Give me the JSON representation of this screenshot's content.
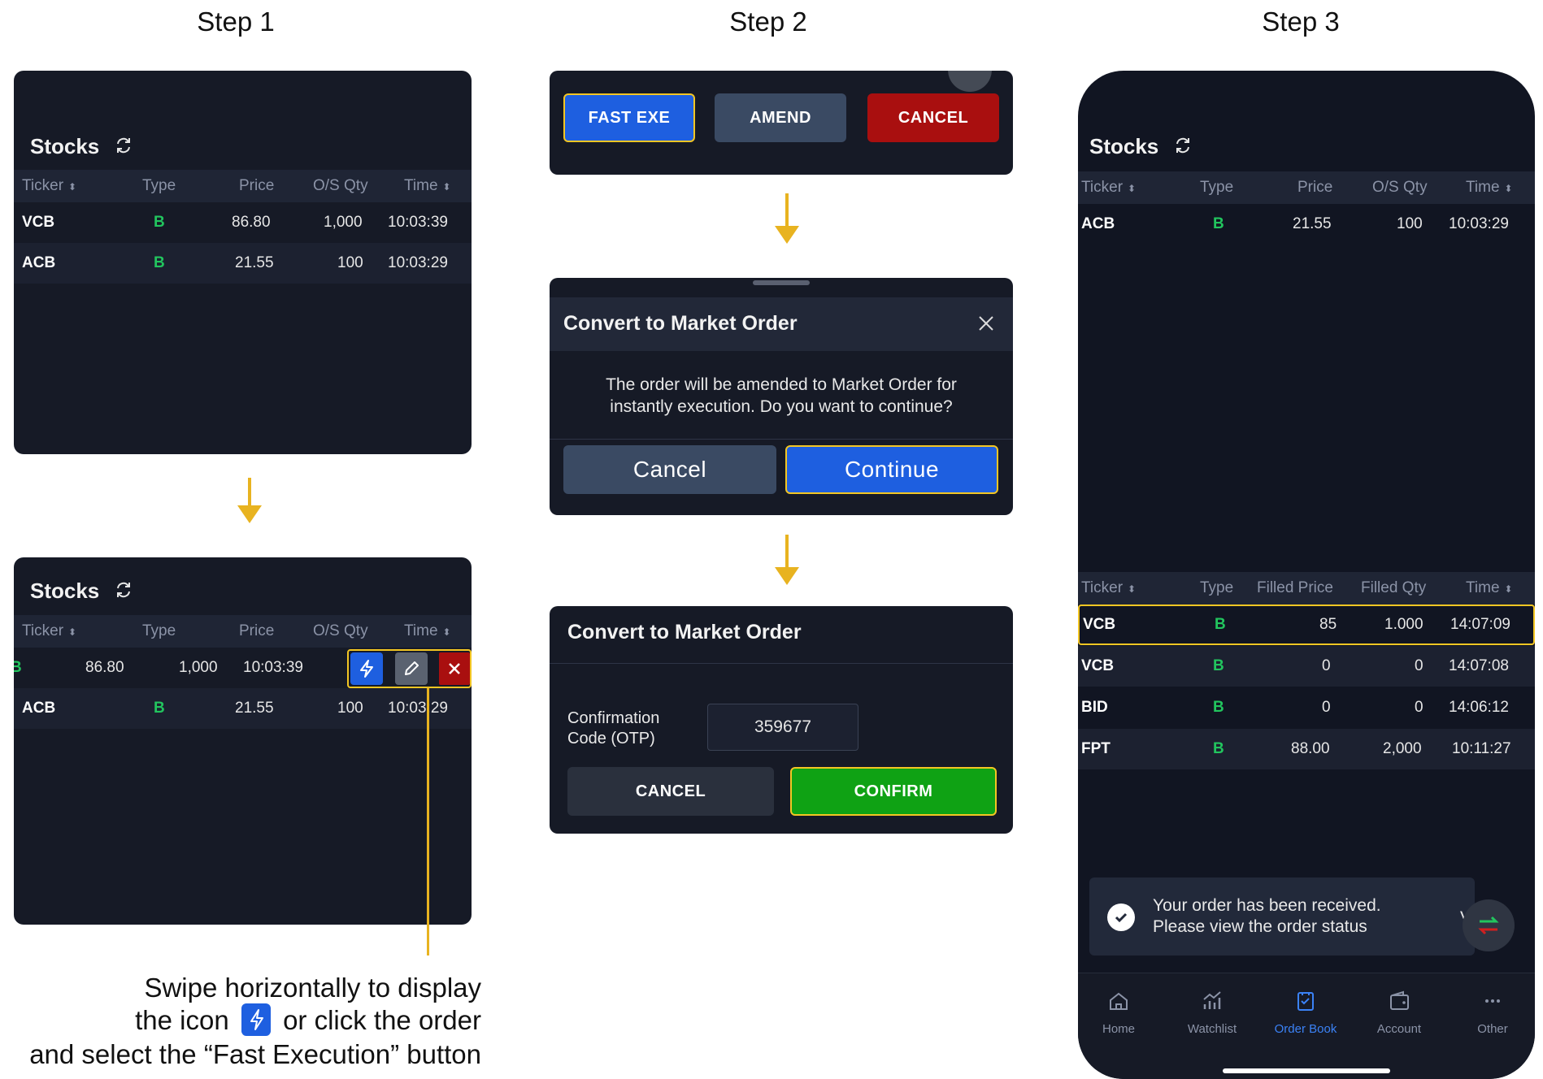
{
  "steps": {
    "s1": "Step 1",
    "s2": "Step 2",
    "s3": "Step 3"
  },
  "step1": {
    "title": "Stocks",
    "headers": [
      "Ticker",
      "Type",
      "Price",
      "O/S Qty",
      "Time"
    ],
    "rows": [
      {
        "ticker": "VCB",
        "type": "B",
        "price": "86.80",
        "qty": "1,000",
        "time": "10:03:39"
      },
      {
        "ticker": "ACB",
        "type": "B",
        "price": "21.55",
        "qty": "100",
        "time": "10:03:29"
      }
    ]
  },
  "step1b": {
    "title": "Stocks",
    "headers": [
      "Ticker",
      "Type",
      "Price",
      "O/S Qty",
      "Time"
    ],
    "swiped_row": {
      "type_fragment": "B",
      "price": "86.80",
      "qty": "1,000",
      "time": "10:03:39"
    },
    "row2": {
      "ticker": "ACB",
      "type": "B",
      "price": "21.55",
      "qty": "100",
      "time": "10:03:29"
    },
    "actions": {
      "fast": "lightning-icon",
      "edit": "pencil-icon",
      "cancel": "close-icon"
    }
  },
  "caption": {
    "line1": "Swipe horizontally to display",
    "line2a": "the icon",
    "line2b": "or click the order",
    "line3": "and select the “Fast Execution” button"
  },
  "step2": {
    "buttons": {
      "fast": "FAST EXE",
      "amend": "AMEND",
      "cancel": "CANCEL"
    },
    "dialog": {
      "title": "Convert to Market Order",
      "line1": "The order will be amended to Market Order for",
      "line2": "instantly execution. Do you want to continue?",
      "cancel": "Cancel",
      "continue": "Continue"
    },
    "otp": {
      "title": "Convert to Market Order",
      "label1": "Confirmation",
      "label2": "Code (OTP)",
      "value": "359677",
      "cancel": "CANCEL",
      "confirm": "CONFIRM"
    }
  },
  "step3": {
    "title": "Stocks",
    "headers": [
      "Ticker",
      "Type",
      "Price",
      "O/S Qty",
      "Time"
    ],
    "rows": [
      {
        "ticker": "ACB",
        "type": "B",
        "price": "21.55",
        "qty": "100",
        "time": "10:03:29"
      }
    ],
    "headers2": [
      "Ticker",
      "Type",
      "Filled Price",
      "Filled Qty",
      "Time"
    ],
    "rows2": [
      {
        "ticker": "VCB",
        "type": "B",
        "price": "85",
        "qty": "1.000",
        "time": "14:07:09"
      },
      {
        "ticker": "VCB",
        "type": "B",
        "price": "0",
        "qty": "0",
        "time": "14:07:08"
      },
      {
        "ticker": "BID",
        "type": "B",
        "price": "0",
        "qty": "0",
        "time": "14:06:12"
      },
      {
        "ticker": "FPT",
        "type": "B",
        "price": "88.00",
        "qty": "2,000",
        "time": "10:11:27"
      }
    ],
    "toast": {
      "line1": "Your order has been received.",
      "line2": "Please view the order status",
      "trail": "V"
    },
    "nav": [
      "Home",
      "Watchlist",
      "Order Book",
      "Account",
      "Other"
    ]
  },
  "colors": {
    "accent": "#f3c623",
    "blue": "#1e5fe0",
    "green": "#0fa214",
    "red": "#a90f0f"
  }
}
